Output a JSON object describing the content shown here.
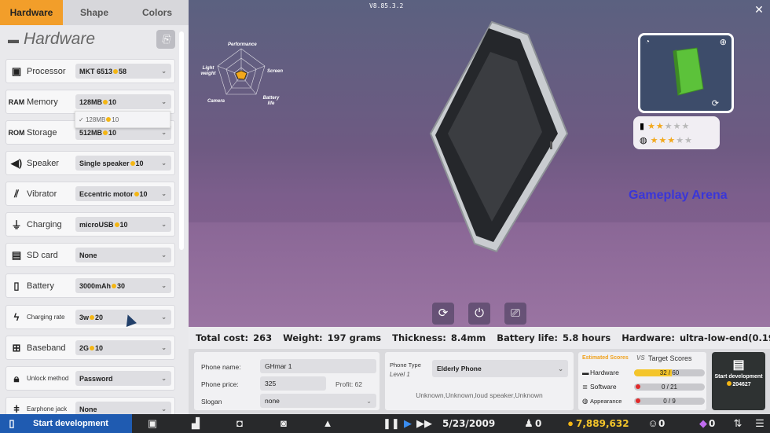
{
  "version": "V8.85.3.2",
  "tabs": [
    {
      "label": "Hardware"
    },
    {
      "label": "Shape"
    },
    {
      "label": "Colors"
    }
  ],
  "panel": {
    "title": "Hardware",
    "export_icon": "export-icon"
  },
  "components": [
    {
      "name": "Processor",
      "icon": "cpu-icon",
      "value": "MKT 6513",
      "cost": "58"
    },
    {
      "name": "Memory",
      "icon": "ram-icon",
      "icon_text": "RAM",
      "value": "128MB",
      "cost": "10"
    },
    {
      "name": "Storage",
      "icon": "rom-icon",
      "icon_text": "ROM",
      "value": "512MB",
      "cost": "10"
    },
    {
      "name": "Speaker",
      "icon": "speaker-icon",
      "value": "Single speaker",
      "cost": "10"
    },
    {
      "name": "Vibrator",
      "icon": "vibrator-icon",
      "value": "Eccentric motor",
      "cost": "10"
    },
    {
      "name": "Charging",
      "icon": "plug-icon",
      "value": "microUSB",
      "cost": "10"
    },
    {
      "name": "SD card",
      "icon": "sdcard-icon",
      "value": "None",
      "cost": ""
    },
    {
      "name": "Battery",
      "icon": "battery-icon",
      "value": "3000mAh",
      "cost": "30"
    },
    {
      "name": "Charging rate",
      "icon": "bolt-icon",
      "value": "3w",
      "cost": "20"
    },
    {
      "name": "Baseband",
      "icon": "antenna-icon",
      "value": "2G",
      "cost": "10"
    },
    {
      "name": "Unlock method",
      "icon": "lock-icon",
      "value": "Password",
      "cost": ""
    },
    {
      "name": "Earphone jack",
      "icon": "earphone-icon",
      "value": "None",
      "cost": ""
    }
  ],
  "memory_dropdown": {
    "value": "128MB",
    "cost": "10"
  },
  "radar": {
    "labels": [
      "Performance",
      "Screen",
      "Battery life",
      "Camera",
      "Light weight"
    ]
  },
  "arena_label": "Gameplay Arena",
  "ratings": [
    {
      "icon": "phone-icon",
      "stars": 2,
      "max": 5
    },
    {
      "icon": "palette-icon",
      "stars": 3,
      "max": 5
    }
  ],
  "stats": {
    "total_cost_label": "Total cost:",
    "total_cost": "263",
    "weight_label": "Weight:",
    "weight": "197 grams",
    "thickness_label": "Thickness:",
    "thickness": "8.4mm",
    "battery_label": "Battery life:",
    "battery": "5.8 hours",
    "hardware_label": "Hardware:",
    "hardware": "ultra-low-end(0.19)"
  },
  "phone_form": {
    "name_label": "Phone name:",
    "name": "GHmar 1",
    "price_label": "Phone price:",
    "price": "325",
    "profit": "Profit: 62",
    "slogan_label": "Slogan",
    "slogan": "none"
  },
  "phone_type": {
    "label": "Phone Type",
    "level": "Level 1",
    "value": "Elderly Phone",
    "features": "Unknown,Unknown,loud speaker,Unknown"
  },
  "scores": {
    "estimated_label": "Estimated Scores",
    "vs": "VS",
    "target_label": "Target Scores",
    "rows": [
      {
        "name": "Hardware",
        "icon": "chip-icon",
        "current": 32,
        "target": 60,
        "text": "32 / 60"
      },
      {
        "name": "Software",
        "icon": "stack-icon",
        "current": 0,
        "target": 21,
        "text": "0 / 21"
      },
      {
        "name": "Appearance",
        "icon": "palette-icon",
        "current": 0,
        "target": 9,
        "text": "0 / 9"
      }
    ]
  },
  "start_tile": {
    "label": "Start development",
    "cost": "204627"
  },
  "taskbar": {
    "start_label": "Start development",
    "date": "5/23/2009",
    "employees": "0",
    "money": "7,889,632",
    "fans": "0",
    "gems": "0"
  },
  "colors": {
    "tab_active": "#f29e2a",
    "start": "#1f5bb1",
    "arena": "#3a36d8",
    "phone_green": "#5cc23a"
  }
}
